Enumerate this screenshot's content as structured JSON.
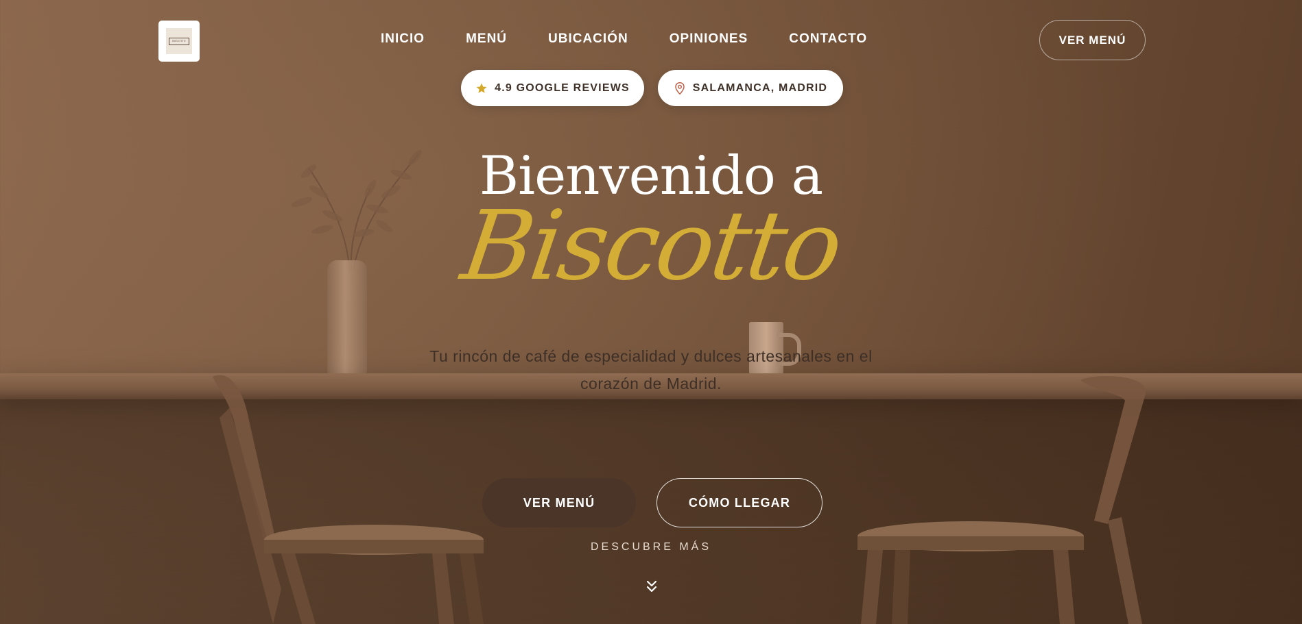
{
  "brand": {
    "logo_text": "BISCOTTO"
  },
  "nav": {
    "items": [
      {
        "label": "INICIO"
      },
      {
        "label": "MENÚ"
      },
      {
        "label": "UBICACIÓN"
      },
      {
        "label": "OPINIONES"
      },
      {
        "label": "CONTACTO"
      }
    ],
    "cta_label": "VER MENÚ"
  },
  "badges": {
    "reviews": {
      "label": "4.9 GOOGLE REVIEWS",
      "icon": "star-icon"
    },
    "location": {
      "label": "SALAMANCA, MADRID",
      "icon": "map-pin-icon"
    }
  },
  "hero": {
    "title_line1": "Bienvenido a",
    "title_line2": "Biscotto",
    "subtitle": "Tu rincón de café de especialidad y dulces artesanales en el corazón de Madrid.",
    "primary_cta": "VER MENÚ",
    "secondary_cta": "CÓMO LLEGAR",
    "scroll_hint": "DESCUBRE MÁS"
  },
  "colors": {
    "accent_gold": "#d4ad36",
    "button_dark": "#4b3529",
    "star": "#d4a82a",
    "pin": "#c0604a"
  }
}
